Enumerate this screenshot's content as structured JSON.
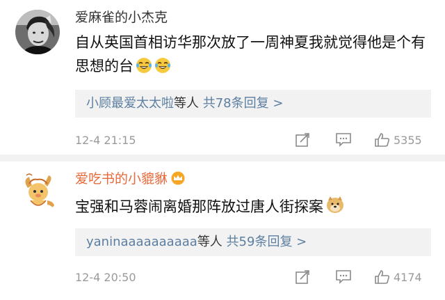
{
  "comments": [
    {
      "author": "爱麻雀的小杰克",
      "author_color": "#333333",
      "avatar": "person-portrait",
      "text": "自从英国首相访华那次放了一周神夏我就觉得他是个有思想的台",
      "emoji": [
        "laughing-tears-emoji",
        "laughing-tears-emoji"
      ],
      "reply_users": "小顾最爱太太啦",
      "reply_suffix": "等人",
      "reply_count": "共78条回复 >",
      "timestamp": "12-4 21:15",
      "like_count": "5355"
    },
    {
      "author": "爱吃书的小貔貅",
      "author_color": "#e8693a",
      "avatar": "pixiu-cartoon",
      "badge": "vip-crown-icon",
      "text": "宝强和马蓉闹离婚那阵放过唐人街探案",
      "emoji": [
        "doge-emoji"
      ],
      "reply_users": "yaninaaaaaaaaaa",
      "reply_suffix": "等人",
      "reply_count": "共59条回复 >",
      "timestamp": "12-4 20:50",
      "like_count": "4174"
    }
  ],
  "colors": {
    "link": "#5c7ea0",
    "meta": "#9a9a9a",
    "reply_bg": "#f2f2f2"
  }
}
